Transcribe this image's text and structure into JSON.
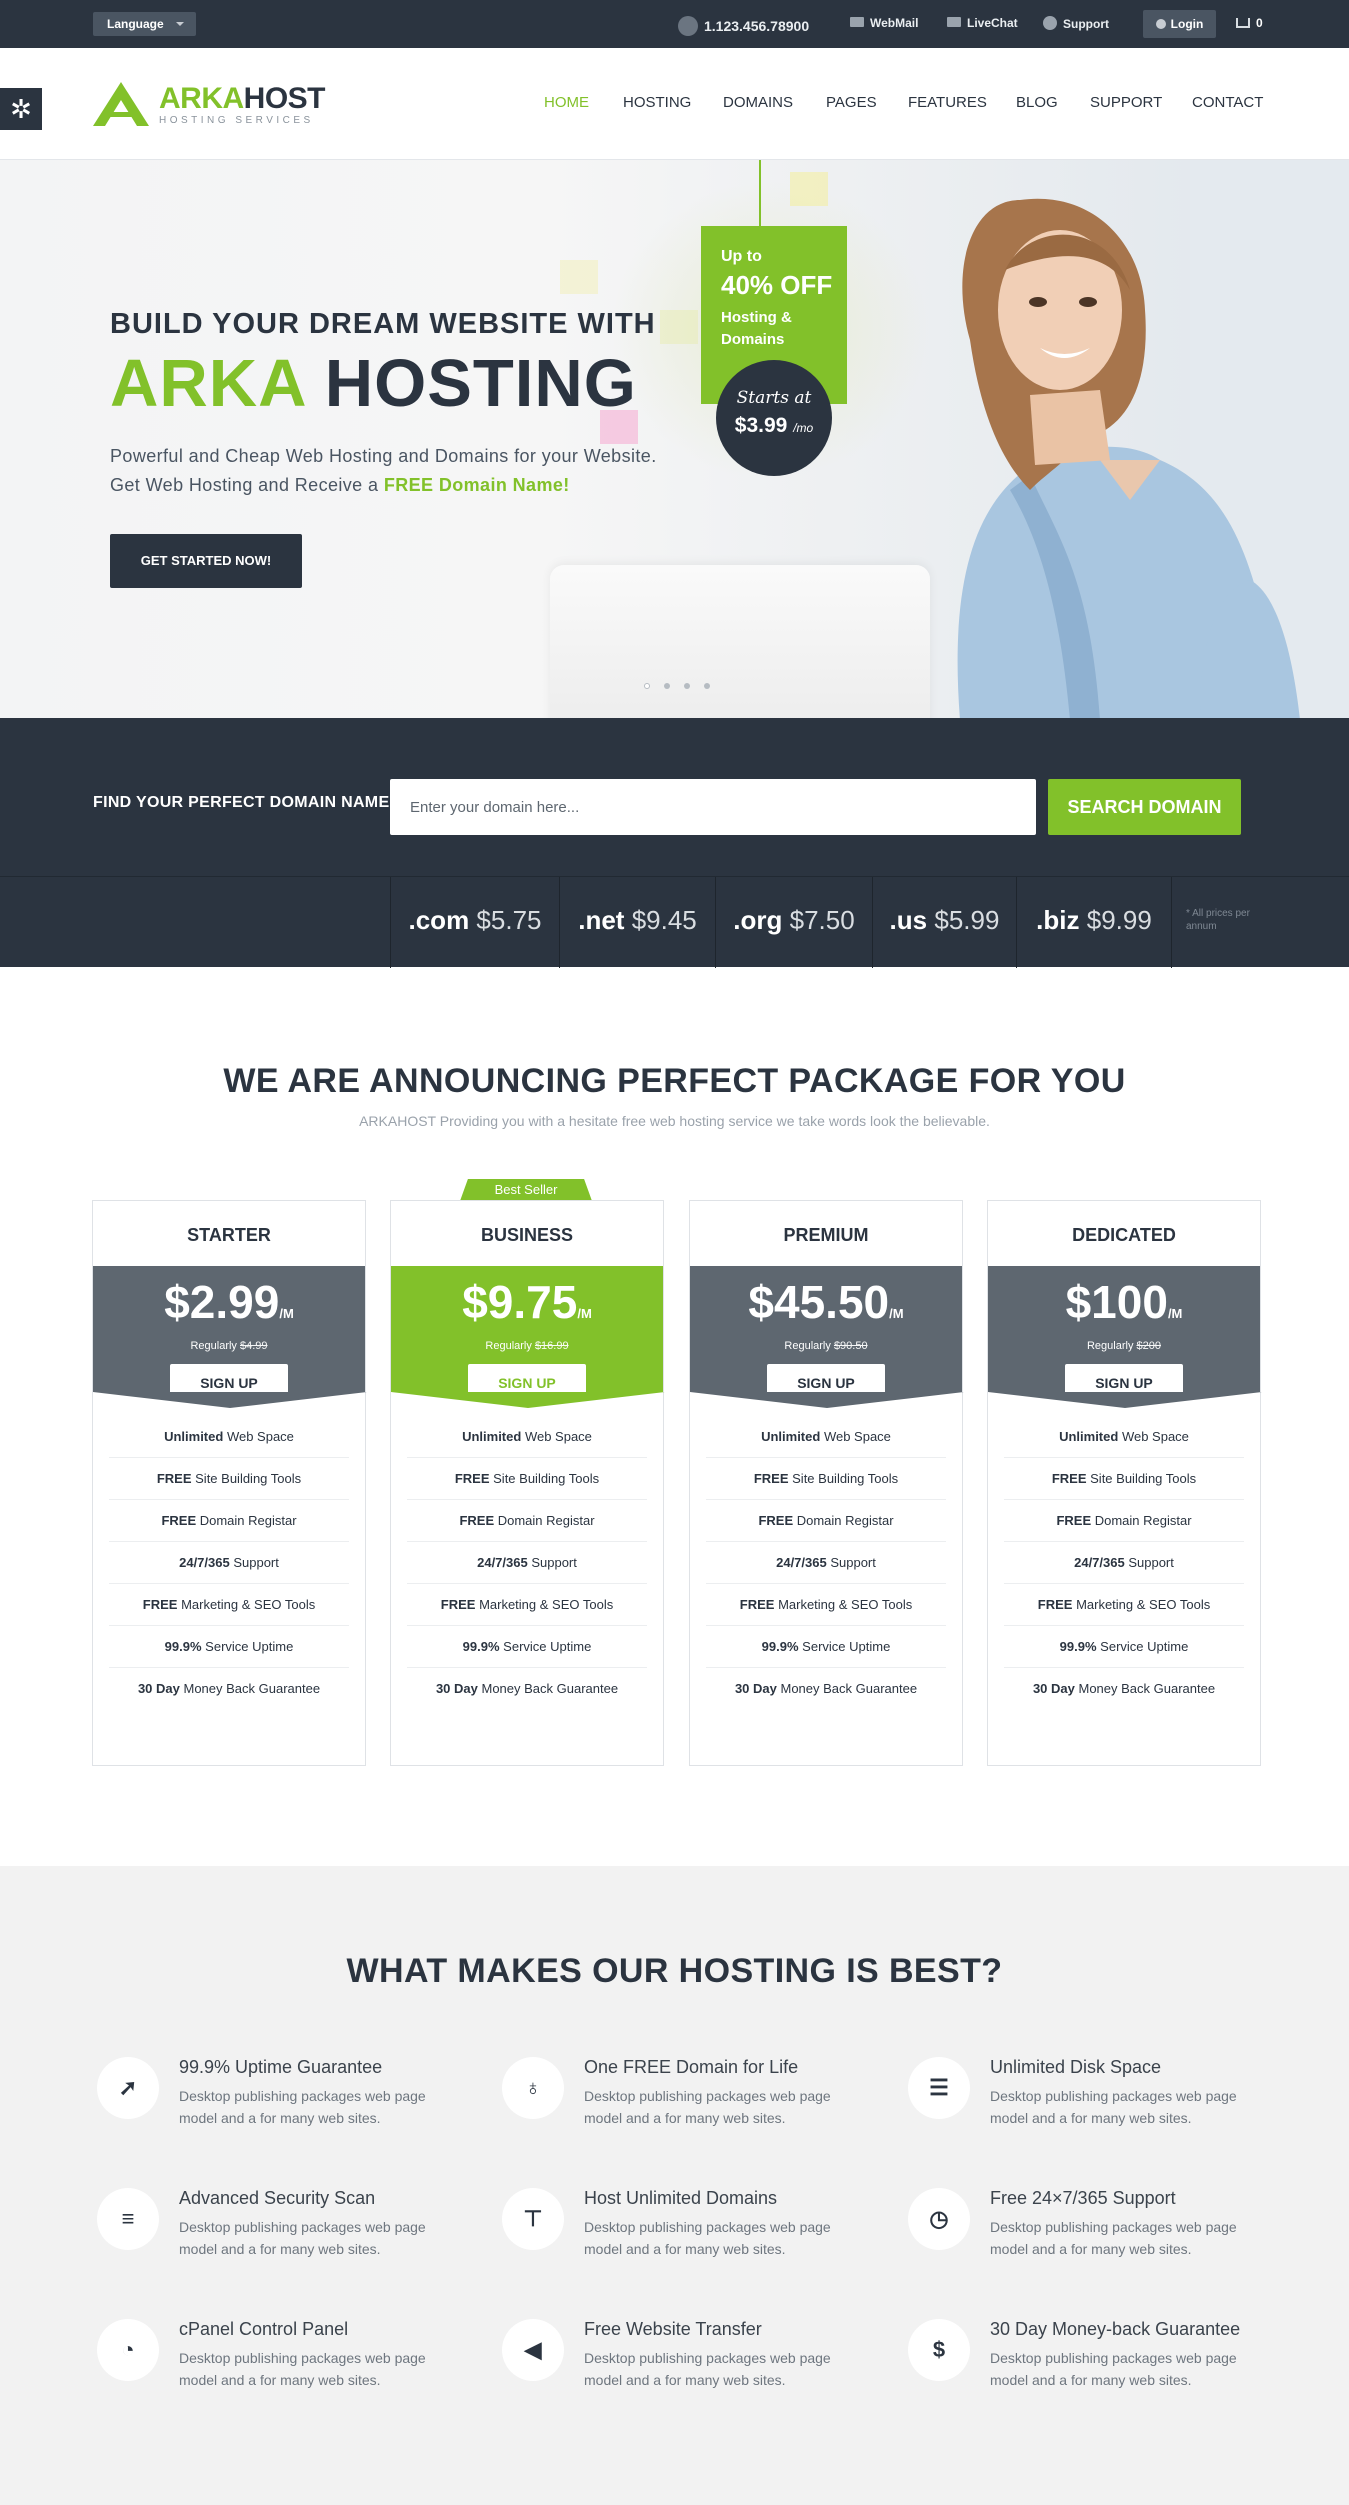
{
  "topbar": {
    "language": "Language",
    "phone": "1.123.456.78900",
    "webmail": "WebMail",
    "livechat": "LiveChat",
    "support": "Support",
    "login": "Login",
    "cart_count": "0"
  },
  "logo": {
    "part1": "ARKA",
    "part2": "HOST",
    "tagline": "HOSTING SERVICES"
  },
  "nav": [
    "HOME",
    "HOSTING",
    "DOMAINS",
    "PAGES",
    "FEATURES",
    "BLOG",
    "SUPPORT",
    "CONTACT"
  ],
  "hero": {
    "line1": "BUILD YOUR DREAM WEBSITE WITH",
    "line2a": "ARKA",
    "line2b": "HOSTING",
    "p1": "Powerful and Cheap Web Hosting and Domains for your Website.",
    "p2a": "Get Web Hosting and Receive a",
    "p2b": "FREE Domain Name!",
    "cta": "GET STARTED NOW!",
    "tag_upto": "Up to",
    "tag_off": "40% OFF",
    "tag_what": "Hosting & Domains",
    "starts_at": "Starts at",
    "start_price": "$3.99",
    "per": "/mo"
  },
  "domain": {
    "label": "FIND YOUR PERFECT DOMAIN NAME:",
    "placeholder": "Enter your domain here...",
    "button": "SEARCH DOMAIN",
    "tlds": [
      {
        "ext": ".com",
        "price": "$5.75"
      },
      {
        "ext": ".net",
        "price": "$9.45"
      },
      {
        "ext": ".org",
        "price": "$7.50"
      },
      {
        "ext": ".us",
        "price": "$5.99"
      },
      {
        "ext": ".biz",
        "price": "$9.99"
      }
    ],
    "note": "* All prices per annum"
  },
  "packages": {
    "title": "WE ARE ANNOUNCING PERFECT PACKAGE FOR YOU",
    "subtitle": "ARKAHOST Providing you with a hesitate free web hosting service we take words look the believable.",
    "best_seller": "Best Seller",
    "regularly": "Regularly",
    "per": "/M",
    "signup": "SIGN UP",
    "plans": [
      {
        "name": "STARTER",
        "price": "$2.99",
        "regular": "$4.99"
      },
      {
        "name": "BUSINESS",
        "price": "$9.75",
        "regular": "$16.99"
      },
      {
        "name": "PREMIUM",
        "price": "$45.50",
        "regular": "$90.50"
      },
      {
        "name": "DEDICATED",
        "price": "$100",
        "regular": "$200"
      }
    ],
    "features": [
      {
        "b": "Unlimited",
        "t": "Web Space"
      },
      {
        "b": "FREE",
        "t": "Site Building Tools"
      },
      {
        "b": "FREE",
        "t": "Domain Registar"
      },
      {
        "b": "24/7/365",
        "t": "Support"
      },
      {
        "b": "FREE",
        "t": "Marketing & SEO Tools"
      },
      {
        "b": "99.9%",
        "t": "Service Uptime"
      },
      {
        "b": "30 Day",
        "t": "Money Back Guarantee"
      }
    ]
  },
  "best": {
    "title": "WHAT MAKES OUR HOSTING IS BEST?",
    "desc": "Desktop publishing packages web page model and a for many web sites.",
    "items": [
      {
        "title": "99.9% Uptime Guarantee",
        "icon": "rocket-icon"
      },
      {
        "title": "One FREE Domain for Life",
        "icon": "lightbulb-icon"
      },
      {
        "title": "Unlimited Disk Space",
        "icon": "database-icon"
      },
      {
        "title": "Advanced Security Scan",
        "icon": "sliders-icon"
      },
      {
        "title": "Host Unlimited Domains",
        "icon": "sitemap-icon"
      },
      {
        "title": "Free 24×7/365 Support",
        "icon": "clock-icon"
      },
      {
        "title": "cPanel Control Panel",
        "icon": "dashboard-icon"
      },
      {
        "title": "Free Website Transfer",
        "icon": "bullhorn-icon"
      },
      {
        "title": "30 Day Money-back Guarantee",
        "icon": "dollar-icon"
      }
    ]
  },
  "colors": {
    "accent": "#82c12a",
    "dark": "#2b3440",
    "gray": "#5e6770"
  }
}
